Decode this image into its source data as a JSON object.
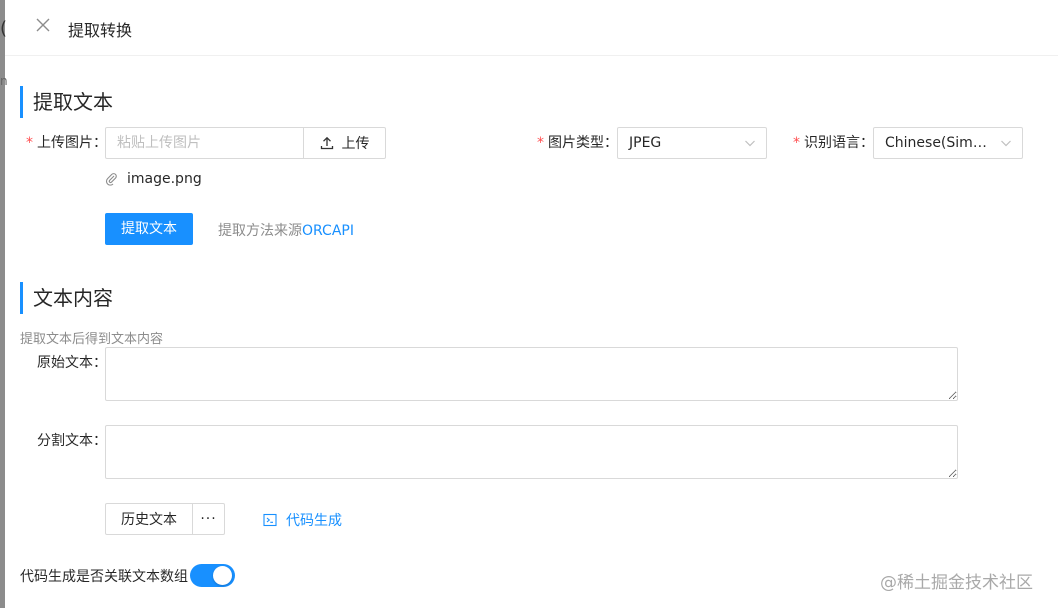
{
  "background": {
    "edge_glyph": "(",
    "edge_glyph2": "n"
  },
  "drawer": {
    "title": "提取转换",
    "close_icon": "close-icon"
  },
  "extract_section": {
    "heading": "提取文本",
    "upload_label": "上传图片",
    "upload_placeholder": "粘贴上传图片",
    "upload_button": "上传",
    "image_type_label": "图片类型",
    "image_type_value": "JPEG",
    "language_label": "识别语言",
    "language_value": "Chinese(Simplif...",
    "file_name": "image.png",
    "extract_button": "提取文本",
    "hint_prefix": "提取方法来源",
    "hint_link": "ORCAPI",
    "required_mark": "*",
    "colon": "："
  },
  "content_section": {
    "heading": "文本内容",
    "description": "提取文本后得到文本内容",
    "original_label": "原始文本",
    "split_label": "分割文本",
    "original_value": "",
    "split_value": "",
    "history_button": "历史文本",
    "more_button": "···",
    "codegen_link": "代码生成"
  },
  "footer": {
    "switch_label": "代码生成是否关联文本数组",
    "switch_on": true,
    "watermark": "@稀土掘金技术社区"
  },
  "colors": {
    "primary": "#1890ff",
    "required": "#ff4d4f",
    "muted": "#8c8c8c"
  }
}
